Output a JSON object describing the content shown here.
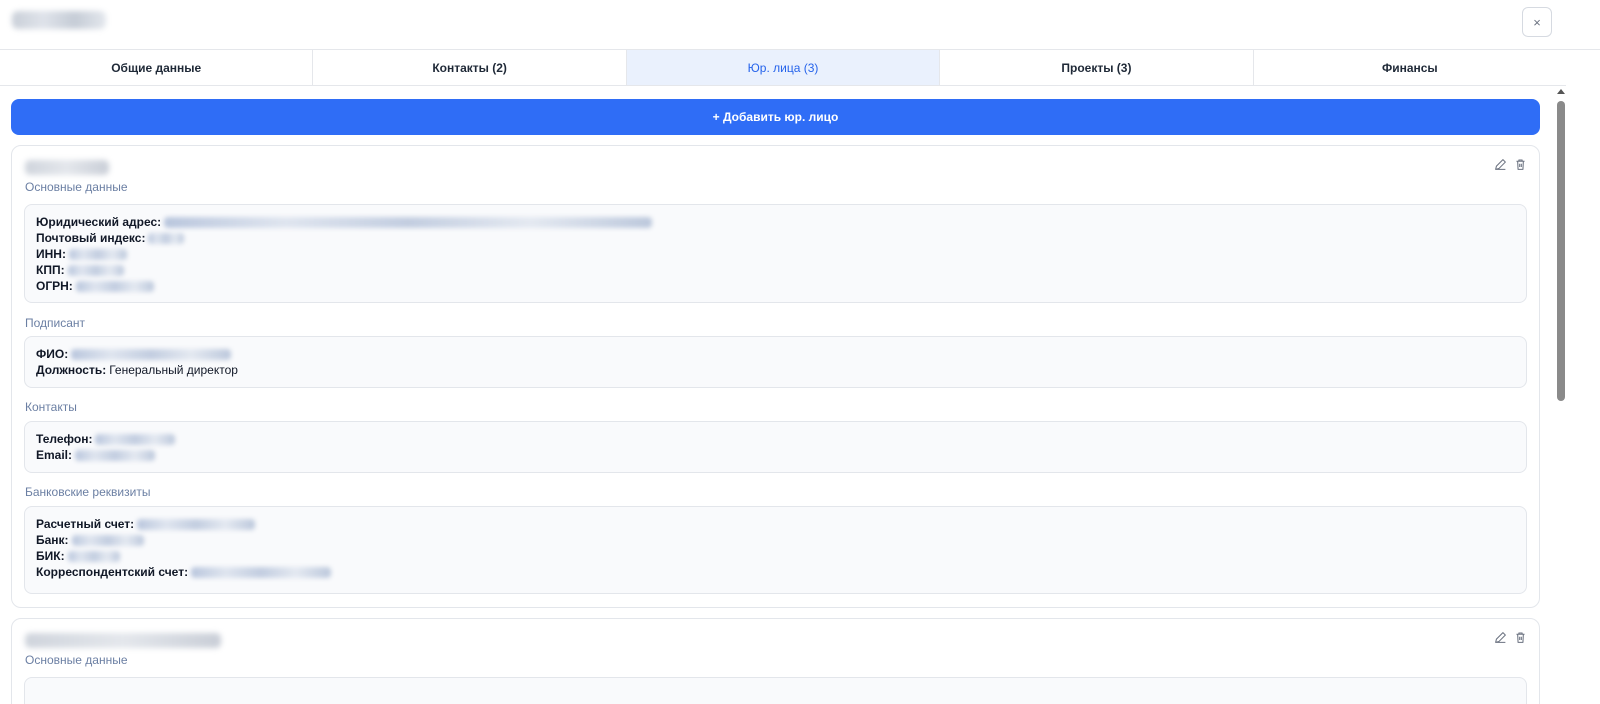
{
  "window": {
    "close_icon": "close-icon",
    "close_label": "×"
  },
  "tabs": [
    {
      "label": "Общие данные",
      "active": false
    },
    {
      "label": "Контакты (2)",
      "active": false
    },
    {
      "label": "Юр. лица (3)",
      "active": true
    },
    {
      "label": "Проекты (3)",
      "active": false
    },
    {
      "label": "Финансы",
      "active": false
    }
  ],
  "add_button": {
    "label": "+ Добавить юр. лицо"
  },
  "accent_color": "#2f6df6",
  "entities": [
    {
      "sections": {
        "main": {
          "title": "Основные данные",
          "fields": [
            {
              "label": "Юридический адрес:"
            },
            {
              "label": "Почтовый индекс:"
            },
            {
              "label": "ИНН:"
            },
            {
              "label": "КПП:"
            },
            {
              "label": "ОГРН:"
            }
          ]
        },
        "signer": {
          "title": "Подписант",
          "fields": [
            {
              "label": "ФИО:"
            },
            {
              "label": "Должность:",
              "value": "Генеральный директор"
            }
          ]
        },
        "contacts": {
          "title": "Контакты",
          "fields": [
            {
              "label": "Телефон:"
            },
            {
              "label": "Email:"
            }
          ]
        },
        "bank": {
          "title": "Банковские реквизиты",
          "fields": [
            {
              "label": "Расчетный счет:"
            },
            {
              "label": "Банк:"
            },
            {
              "label": "БИК:"
            },
            {
              "label": "Корреспондентский счет:"
            }
          ]
        }
      },
      "actions": {
        "edit_icon": "pencil-icon",
        "delete_icon": "trash-icon"
      }
    },
    {
      "sections": {
        "main": {
          "title": "Основные данные"
        }
      },
      "actions": {
        "edit_icon": "pencil-icon",
        "delete_icon": "trash-icon"
      }
    }
  ]
}
